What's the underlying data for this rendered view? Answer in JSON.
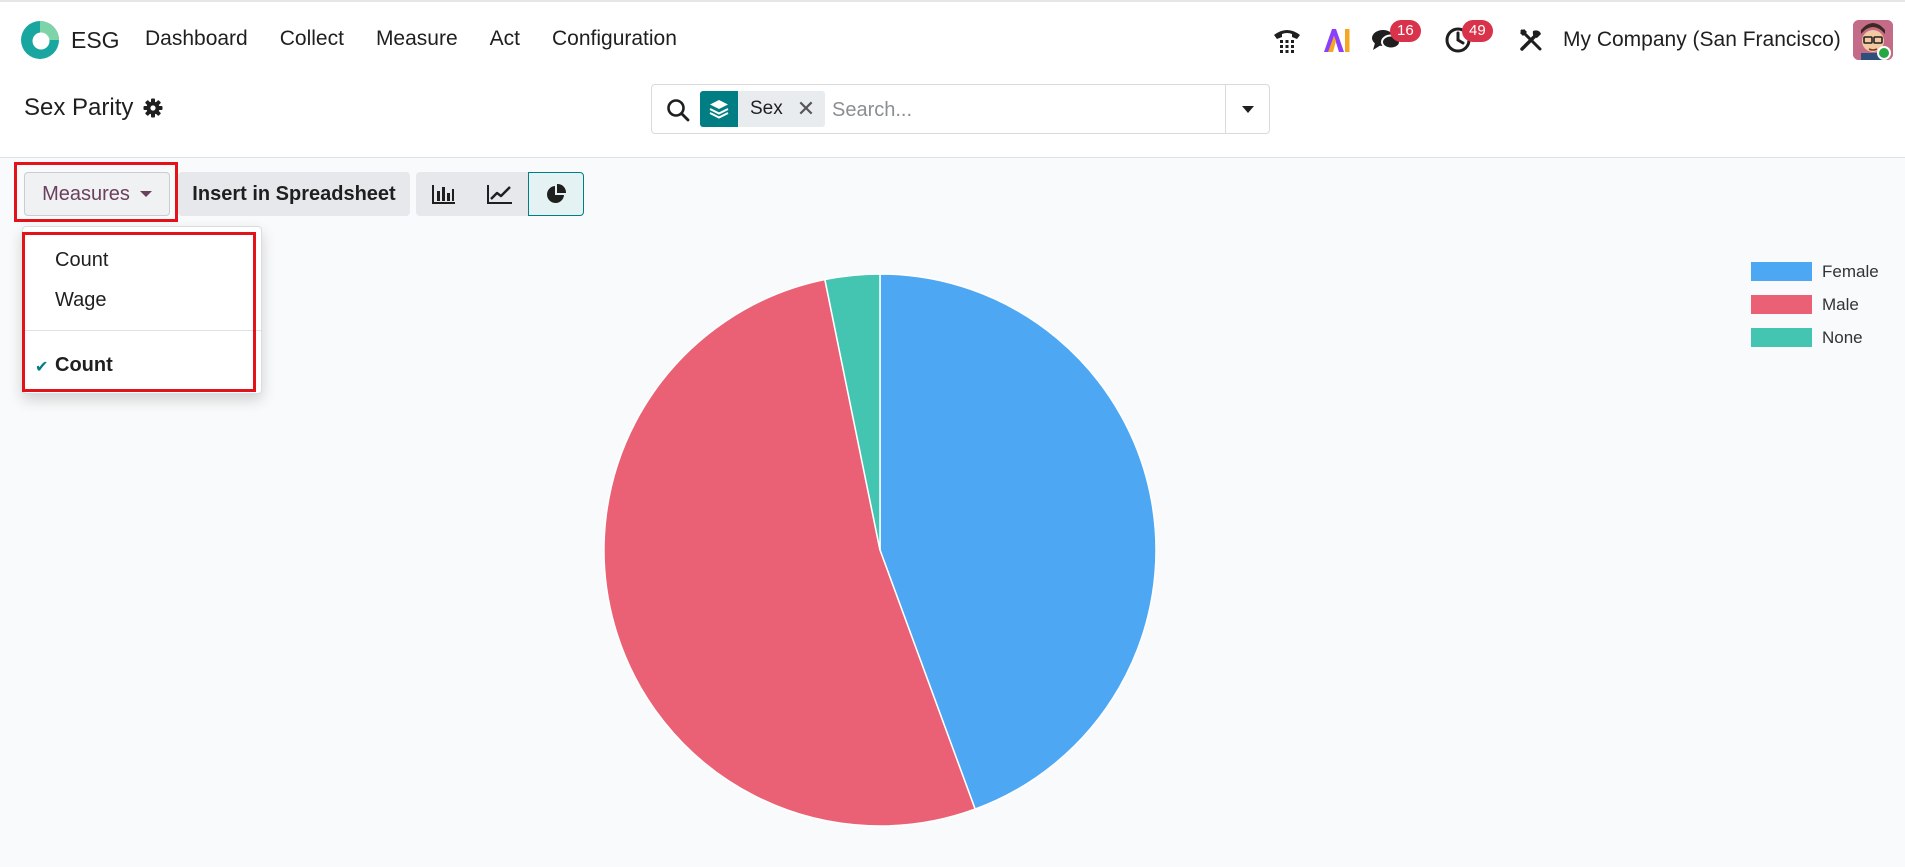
{
  "app": {
    "name": "ESG"
  },
  "nav": {
    "items": [
      {
        "id": "dashboard",
        "label": "Dashboard"
      },
      {
        "id": "collect",
        "label": "Collect"
      },
      {
        "id": "measure",
        "label": "Measure"
      },
      {
        "id": "act",
        "label": "Act"
      },
      {
        "id": "configuration",
        "label": "Configuration"
      }
    ]
  },
  "systray": {
    "messages_count": "16",
    "activities_count": "49",
    "company": "My Company (San Francisco)"
  },
  "control_panel": {
    "title": "Sex Parity",
    "search": {
      "facet_label": "Sex",
      "remove_glyph": "✕",
      "placeholder": "Search..."
    }
  },
  "toolbar": {
    "measures_label": "Measures",
    "insert_spreadsheet_label": "Insert in Spreadsheet",
    "active_chart_type": "pie"
  },
  "measures_dropdown": {
    "options": [
      {
        "label": "Count"
      },
      {
        "label": "Wage"
      }
    ],
    "selected": {
      "label": "Count",
      "check_glyph": "✔"
    }
  },
  "colors": {
    "accent": "#017e84",
    "highlight": "#e3131b",
    "badge": "#d9334b"
  },
  "chart_data": {
    "type": "pie",
    "categories": [
      "Female",
      "Male",
      "None"
    ],
    "values": [
      44.4,
      52.4,
      3.2
    ],
    "colors": [
      "#4ea7f2",
      "#ea6175",
      "#43c5b1"
    ],
    "legend_position": "top-right"
  }
}
